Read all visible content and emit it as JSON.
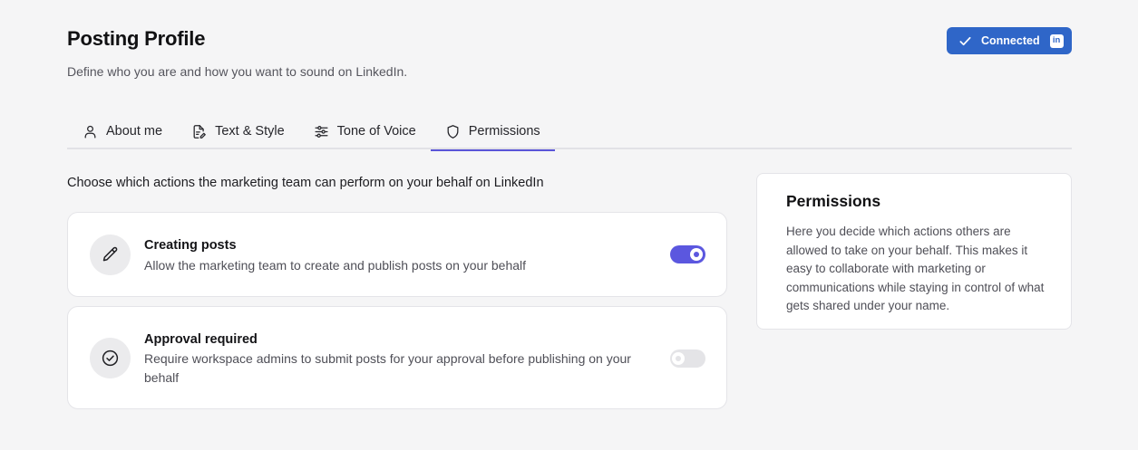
{
  "header": {
    "title": "Posting Profile",
    "subtitle": "Define who you are and how you want to sound on LinkedIn.",
    "connection_status": "Connected",
    "linkedin_badge": "in"
  },
  "tabs": [
    {
      "label": "About me",
      "icon": "person-icon",
      "active": false
    },
    {
      "label": "Text & Style",
      "icon": "document-edit-icon",
      "active": false
    },
    {
      "label": "Tone of Voice",
      "icon": "sliders-icon",
      "active": false
    },
    {
      "label": "Permissions",
      "icon": "shield-icon",
      "active": true
    }
  ],
  "permissions": {
    "lead": "Choose which actions the marketing team can perform on your behalf on LinkedIn",
    "items": [
      {
        "icon": "pencil-icon",
        "title": "Creating posts",
        "description": "Allow the marketing team to create and publish posts on your behalf",
        "enabled": true
      },
      {
        "icon": "check-circle-icon",
        "title": "Approval required",
        "description": "Require workspace admins to submit posts for your approval before publishing on your behalf",
        "enabled": false
      }
    ]
  },
  "sidebar_info": {
    "title": "Permissions",
    "body": "Here you decide which actions others are allowed to take on your behalf. This makes it easy to collaborate with marketing or communications while staying in control of what gets shared under your name."
  },
  "colors": {
    "accent": "#5b57df",
    "linkedin_blue": "#2f66c8",
    "background": "#f5f5f6"
  }
}
